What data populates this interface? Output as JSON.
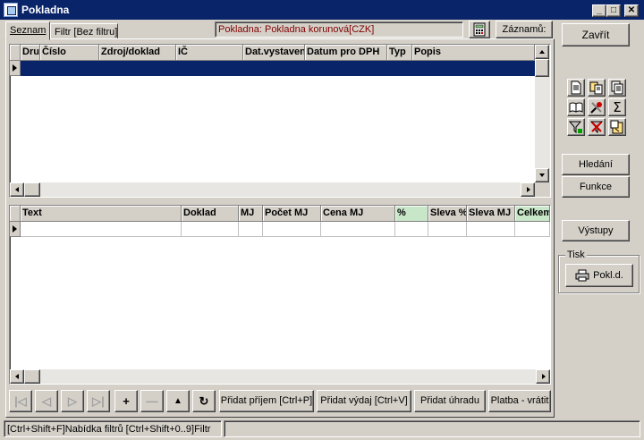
{
  "window": {
    "title": "Pokladna"
  },
  "window_controls": {
    "minimize": "_",
    "maximize": "□",
    "close": "✕"
  },
  "tabs": [
    {
      "label": "Seznam",
      "active": true
    },
    {
      "label": "Filtr [Bez filtru]",
      "active": false
    }
  ],
  "infobox": "Pokladna: Pokladna korunová[CZK]",
  "records_button": "Záznamů:",
  "top_grid": {
    "columns": [
      "Dru",
      "Číslo",
      "Zdroj/doklad",
      "IČ",
      "Dat.vystavení",
      "Datum pro DPH",
      "Typ",
      "Popis"
    ]
  },
  "bottom_grid": {
    "columns": [
      "Text",
      "Doklad",
      "MJ",
      "Počet MJ",
      "Cena MJ",
      "%",
      "Sleva %",
      "Sleva MJ",
      "Celkem"
    ]
  },
  "right_panel": {
    "close_button": "Zavřít",
    "search_button": "Hledání",
    "functions_button": "Funkce",
    "outputs_button": "Výstupy",
    "print_group_label": "Tisk",
    "print_button": "Pokl.d.",
    "tool_icons": [
      "document-icon",
      "copy-docs-icon",
      "pages-icon",
      "book-icon",
      "tools-icon",
      "sum-icon",
      "filter-icon",
      "clear-filter-icon",
      "export-icon"
    ]
  },
  "nav_buttons": [
    {
      "name": "first-record-icon",
      "glyph": "|◁",
      "enabled": false
    },
    {
      "name": "prev-record-icon",
      "glyph": "◁",
      "enabled": false
    },
    {
      "name": "next-record-icon",
      "glyph": "▷",
      "enabled": false
    },
    {
      "name": "last-record-icon",
      "glyph": "▷|",
      "enabled": false
    },
    {
      "name": "add-record-icon",
      "glyph": "+",
      "enabled": true
    },
    {
      "name": "delete-record-icon",
      "glyph": "—",
      "enabled": false
    },
    {
      "name": "move-up-icon",
      "glyph": "▲",
      "enabled": true
    },
    {
      "name": "refresh-icon",
      "glyph": "↻",
      "enabled": true
    }
  ],
  "actions": {
    "add_income": "Přidat příjem [Ctrl+P]",
    "add_expense": "Přidat výdaj [Ctrl+V]",
    "add_payment": "Přidat úhradu",
    "payment_return": "Platba - vrátit"
  },
  "statusbar": {
    "left": "[Ctrl+Shift+F]Nabídka filtrů [Ctrl+Shift+0..9]Filtr",
    "right": ""
  },
  "colors": {
    "titlebar": "#0a246a",
    "selection": "#0a246a",
    "face": "#d4d0c8",
    "info_text": "#800000",
    "green_header": "#c8e6c8"
  }
}
